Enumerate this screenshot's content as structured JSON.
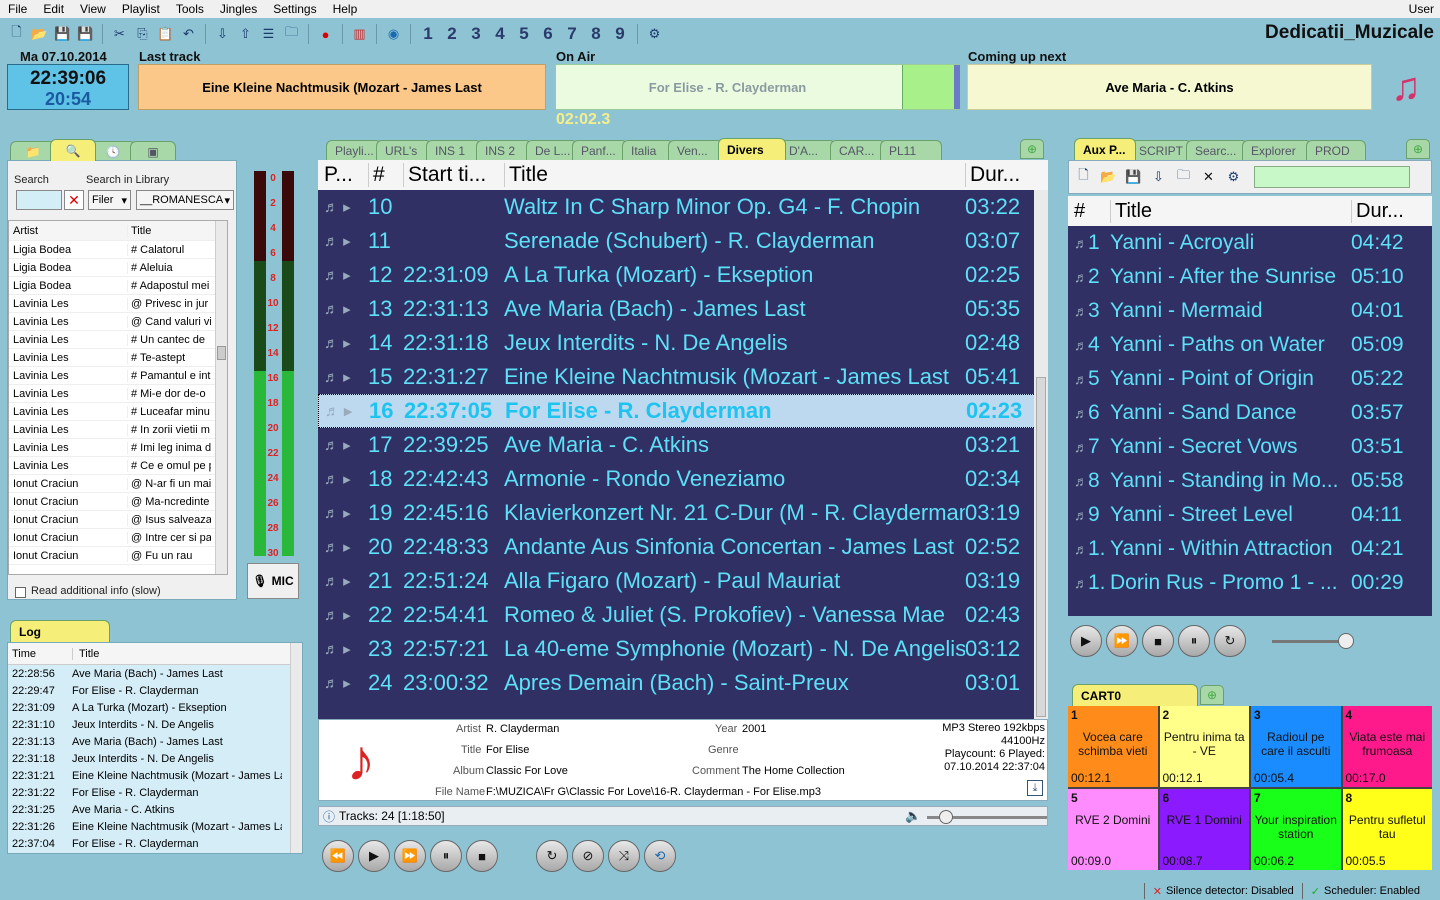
{
  "menu": [
    "File",
    "Edit",
    "View",
    "Playlist",
    "Tools",
    "Jingles",
    "Settings",
    "Help"
  ],
  "user": "User",
  "toolbar_numbers": [
    "1",
    "2",
    "3",
    "4",
    "5",
    "6",
    "7",
    "8",
    "9"
  ],
  "station": "Dedicatii_Muzicale",
  "date": "Ma 07.10.2014",
  "time": "22:39:06",
  "remaining": "20:54",
  "last_track": {
    "label": "Last track",
    "title": "Eine Kleine Nachtmusik (Mozart - James Last"
  },
  "on_air": {
    "label": "On Air",
    "title": "For Elise - R. Clayderman",
    "time": "02:02.3"
  },
  "coming_next": {
    "label": "Coming up next",
    "title": "Ave Maria - C. Atkins"
  },
  "library": {
    "search_label": "Search",
    "search_in_label": "Search in Library",
    "filter_value": "Filer",
    "library_value": "__ROMANESCA",
    "col_artist": "Artist",
    "col_title": "Title",
    "rows": [
      [
        "Ligia Bodea",
        "# Calatorul"
      ],
      [
        "Ligia Bodea",
        "# Aleluia"
      ],
      [
        "Ligia Bodea",
        "# Adapostul mei"
      ],
      [
        "Lavinia Les",
        "@ Privesc in jur"
      ],
      [
        "Lavinia Les",
        "@ Cand valuri vi"
      ],
      [
        "Lavinia Les",
        "# Un cantec de"
      ],
      [
        "Lavinia Les",
        "# Te-astept"
      ],
      [
        "Lavinia Les",
        "# Pamantul e int"
      ],
      [
        "Lavinia Les",
        "# Mi-e dor de-o"
      ],
      [
        "Lavinia Les",
        "# Luceafar minu"
      ],
      [
        "Lavinia Les",
        "# In zorii vietii m"
      ],
      [
        "Lavinia Les",
        "# Imi leg inima d"
      ],
      [
        "Lavinia Les",
        "# Ce e omul pe p"
      ],
      [
        "Ionut Craciun",
        "@ N-ar fi un mai"
      ],
      [
        "Ionut Craciun",
        "@ Ma-ncredinte"
      ],
      [
        "Ionut Craciun",
        "@ Isus salveaza"
      ],
      [
        "Ionut Craciun",
        "@ Intre cer si pa"
      ],
      [
        "Ionut Craciun",
        "@ Fu un rau"
      ]
    ],
    "read_info": "Read additional info (slow)"
  },
  "vu_labels": [
    "0",
    "2",
    "4",
    "6",
    "8",
    "10",
    "12",
    "14",
    "16",
    "18",
    "20",
    "22",
    "24",
    "26",
    "28",
    "30"
  ],
  "mic_label": "MIC",
  "log": {
    "tab": "Log",
    "col_time": "Time",
    "col_title": "Title",
    "rows": [
      [
        "22:28:56",
        "Ave Maria (Bach) - James Last"
      ],
      [
        "22:29:47",
        "For Elise - R. Clayderman"
      ],
      [
        "22:31:09",
        "A La Turka (Mozart) - Ekseption"
      ],
      [
        "22:31:10",
        "Jeux Interdits - N. De Angelis"
      ],
      [
        "22:31:13",
        "Ave Maria (Bach) - James Last"
      ],
      [
        "22:31:18",
        "Jeux Interdits - N. De Angelis"
      ],
      [
        "22:31:21",
        "Eine Kleine Nachtmusik (Mozart - James Las"
      ],
      [
        "22:31:22",
        "For Elise - R. Clayderman"
      ],
      [
        "22:31:25",
        "Ave Maria - C. Atkins"
      ],
      [
        "22:31:26",
        "Eine Kleine Nachtmusik (Mozart - James Las"
      ],
      [
        "22:37:04",
        "For Elise - R. Clayderman"
      ]
    ]
  },
  "playlist": {
    "tabs": [
      "Playli...",
      "URL's",
      "INS 1",
      "INS 2",
      "De L...",
      "Panf...",
      "Italia",
      "Ven...",
      "Divers",
      "D'A...",
      "CAR...",
      "PL11"
    ],
    "active_tab": "Divers",
    "col_p": "P...",
    "col_num": "#",
    "col_start": "Start ti...",
    "col_title": "Title",
    "col_dur": "Dur...",
    "rows": [
      [
        "10",
        "",
        "Waltz In C Sharp Minor Op. G4 - F. Chopin",
        "03:22"
      ],
      [
        "11",
        "",
        "Serenade (Schubert) - R. Clayderman",
        "03:07"
      ],
      [
        "12",
        "22:31:09",
        "A La Turka (Mozart) - Ekseption",
        "02:25"
      ],
      [
        "13",
        "22:31:13",
        "Ave Maria (Bach) - James Last",
        "05:35"
      ],
      [
        "14",
        "22:31:18",
        "Jeux Interdits - N. De Angelis",
        "02:48"
      ],
      [
        "15",
        "22:31:27",
        "Eine Kleine Nachtmusik (Mozart - James Last",
        "05:41"
      ],
      [
        "16",
        "22:37:05",
        "For Elise - R. Clayderman",
        "02:23"
      ],
      [
        "17",
        "22:39:25",
        "Ave Maria - C. Atkins",
        "03:21"
      ],
      [
        "18",
        "22:42:43",
        "Armonie - Rondo Veneziamo",
        "02:34"
      ],
      [
        "19",
        "22:45:16",
        "Klavierkonzert Nr. 21 C-Dur (M - R. Clayderman",
        "03:19"
      ],
      [
        "20",
        "22:48:33",
        "Andante Aus Sinfonia Concertan - James Last",
        "02:52"
      ],
      [
        "21",
        "22:51:24",
        "Alla Figaro (Mozart) - Paul Mauriat",
        "03:19"
      ],
      [
        "22",
        "22:54:41",
        "Romeo & Juliet (S. Prokofiev) - Vanessa Mae",
        "02:43"
      ],
      [
        "23",
        "22:57:21",
        "La 40-eme Symphonie (Mozart) - N. De Angelis",
        "03:12"
      ],
      [
        "24",
        "23:00:32",
        "Apres Demain (Bach) - Saint-Preux",
        "03:01"
      ]
    ]
  },
  "info": {
    "artist_lbl": "Artist",
    "artist": "R. Clayderman",
    "title_lbl": "Title",
    "title": "For Elise",
    "album_lbl": "Album",
    "album": "Classic For Love",
    "file_lbl": "File Name",
    "file": "F:\\MUZICA\\Fr G\\Classic For Love\\16-R. Clayderman - For Elise.mp3",
    "year_lbl": "Year",
    "year": "2001",
    "genre_lbl": "Genre",
    "comment_lbl": "Comment",
    "comment": "The Home Collection",
    "format": "MP3 Stereo 192kbps",
    "freq": "44100Hz",
    "playcount": "Playcount: 6  Played:",
    "played": "07.10.2014 22:37:04"
  },
  "tracks_status": "Tracks: 24 [1:18:50]",
  "aux": {
    "tabs": [
      "Aux P...",
      "SCRIPT",
      "Searc...",
      "Explorer",
      "PROD"
    ],
    "col_num": "#",
    "col_title": "Title",
    "col_dur": "Dur...",
    "rows": [
      [
        "1",
        "Yanni - Acroyali",
        "04:42"
      ],
      [
        "2",
        "Yanni - After the Sunrise",
        "05:10"
      ],
      [
        "3",
        "Yanni - Mermaid",
        "04:01"
      ],
      [
        "4",
        "Yanni - Paths on Water",
        "05:09"
      ],
      [
        "5",
        "Yanni - Point of Origin",
        "05:22"
      ],
      [
        "6",
        "Yanni - Sand Dance",
        "03:57"
      ],
      [
        "7",
        "Yanni - Secret Vows",
        "03:51"
      ],
      [
        "8",
        "Yanni - Standing in Mo...",
        "05:58"
      ],
      [
        "9",
        "Yanni - Street Level",
        "04:11"
      ],
      [
        "1.",
        "Yanni - Within Attraction",
        "04:21"
      ],
      [
        "1.",
        "Dorin Rus - Promo 1 - ...",
        "00:29"
      ]
    ]
  },
  "cart": {
    "tab": "CART0",
    "items": [
      {
        "n": "1",
        "t": "Vocea care schimba vieti",
        "d": "00:12.1",
        "c": "#ff8c1a"
      },
      {
        "n": "2",
        "t": "Pentru inima ta - VE",
        "d": "00:12.1",
        "c": "#ffff8a"
      },
      {
        "n": "3",
        "t": "Radioul pe care il asculti",
        "d": "00:05.4",
        "c": "#1a8cff"
      },
      {
        "n": "4",
        "t": "Viata este mai frumoasa",
        "d": "00:17.0",
        "c": "#ff1a8c"
      },
      {
        "n": "5",
        "t": "RVE 2 Domini",
        "d": "00:09.0",
        "c": "#ff8cff"
      },
      {
        "n": "6",
        "t": "RVE 1 Domini",
        "d": "00:08.7",
        "c": "#8c1aff"
      },
      {
        "n": "7",
        "t": "Your inspiration station",
        "d": "00:06.2",
        "c": "#1aff1a"
      },
      {
        "n": "8",
        "t": "Pentru sufletul tau",
        "d": "00:05.5",
        "c": "#ffff1a"
      }
    ]
  },
  "status": {
    "silence": "Silence detector: Disabled",
    "scheduler": "Scheduler: Enabled"
  }
}
